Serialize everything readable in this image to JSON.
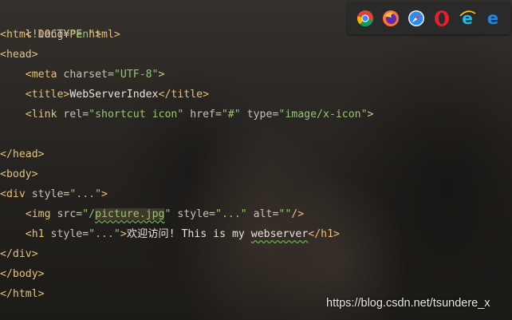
{
  "code": {
    "lines": [
      [
        "<!DOCTYPE html>"
      ],
      [
        "<html",
        " lang=",
        "\"en\"",
        ">"
      ],
      [
        "<head>"
      ],
      [
        "    ",
        "<meta",
        " charset=",
        "\"UTF-8\"",
        ">"
      ],
      [
        "    ",
        "<title>",
        "WebServerIndex",
        "</title>"
      ],
      [
        "    ",
        "<link",
        " rel=",
        "\"shortcut icon\"",
        " href=",
        "\"#\"",
        " type=",
        "\"image/x-icon\"",
        ">"
      ],
      [
        ""
      ],
      [
        "</head>"
      ],
      [
        "<body>"
      ],
      [
        "<div",
        " style=",
        "\"...\"",
        ">"
      ],
      [
        "    ",
        "<img",
        " src=",
        "\"/",
        "picture.jpg",
        "\"",
        " style=",
        "\"...\"",
        " alt=",
        "\"\"",
        "/>"
      ],
      [
        "    ",
        "<h1",
        " style=",
        "\"...\"",
        ">",
        "欢迎访问! This is my ",
        "webserver",
        "</h1>"
      ],
      [
        "</div>"
      ],
      [
        "</body>"
      ],
      [
        "</html>"
      ]
    ]
  },
  "browsers": {
    "icons": [
      "chrome-icon",
      "firefox-icon",
      "safari-icon",
      "opera-icon",
      "ie-icon",
      "edge-icon"
    ]
  },
  "watermark": {
    "text": "https://blog.csdn.net/tsundere_x"
  }
}
